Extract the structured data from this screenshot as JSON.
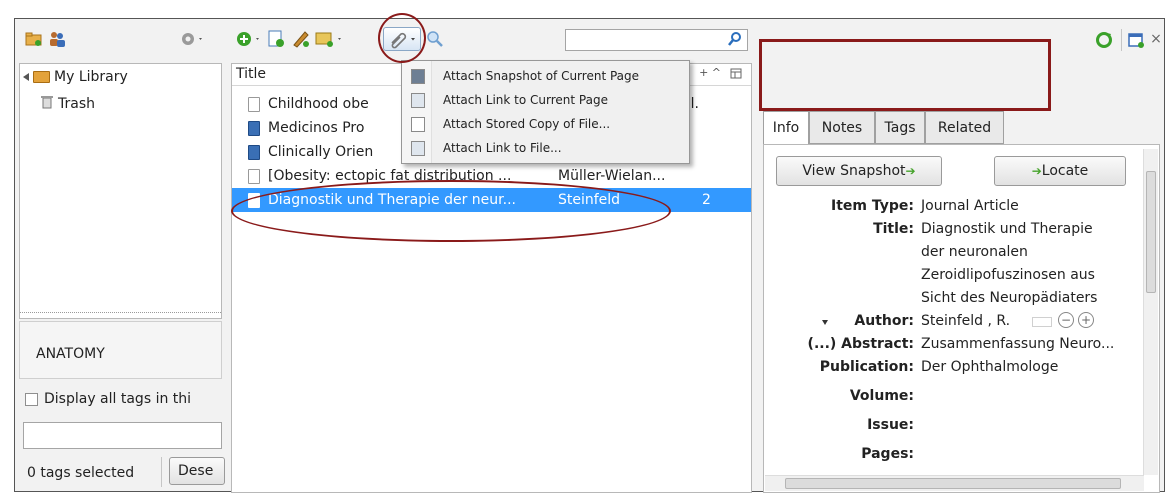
{
  "toolbar": {
    "search_value": "",
    "icons": [
      "new-collection-icon",
      "new-group-icon",
      "actions-gear-icon",
      "new-item-icon",
      "new-note-icon",
      "add-by-identifier-icon",
      "new-note-dropdown-icon",
      "attach-icon",
      "advanced-search-icon",
      "search-icon",
      "sync-icon",
      "fullscreen-icon",
      "close-icon"
    ]
  },
  "library": {
    "items": [
      {
        "label": "My Library"
      },
      {
        "label": "Trash"
      }
    ]
  },
  "tag_selector": {
    "tag": "ANATOMY",
    "display_all_label": "Display all tags in thi",
    "filter_value": "",
    "selected_count": "0 tags selected",
    "deselect_label": "Dese"
  },
  "items": {
    "column_title": "Title",
    "rows": [
      {
        "title": "Childhood obe",
        "extra": "al.",
        "type": "doc"
      },
      {
        "title": "Medicinos Pro",
        "extra": "",
        "type": "book"
      },
      {
        "title": "Clinically Orien",
        "extra": "",
        "type": "book"
      },
      {
        "title": "[Obesity: ectopic fat distribution ...",
        "extra": "Müller-Wielan...",
        "type": "doc"
      },
      {
        "title": "Diagnostik und Therapie der neur...",
        "extra": "Steinfeld",
        "count": "2",
        "type": "doc",
        "selected": true
      }
    ]
  },
  "attach_menu": {
    "items": [
      {
        "label": "Attach Snapshot of Current Page"
      },
      {
        "label": "Attach Link to Current Page"
      },
      {
        "label": "Attach Stored Copy of File..."
      },
      {
        "label": "Attach Link to File..."
      }
    ]
  },
  "item_pane": {
    "tabs": [
      {
        "label": "Info"
      },
      {
        "label": "Notes"
      },
      {
        "label": "Tags"
      },
      {
        "label": "Related"
      }
    ],
    "view_snapshot": "View Snapshot",
    "locate": "Locate",
    "fields": [
      {
        "label": "Item Type:",
        "value": [
          "Journal Article"
        ]
      },
      {
        "label": "Title:",
        "value": [
          "Diagnostik und Therapie",
          "der neuronalen",
          "Zeroidlipofuszinosen aus",
          "Sicht des Neuropädiaters"
        ]
      },
      {
        "label": "Author:",
        "value": [
          "Steinfeld  ,  R."
        ]
      },
      {
        "label": "(...) Abstract:",
        "value": [
          "Zusammenfassung  Neuro..."
        ]
      },
      {
        "label": "Publication:",
        "value": [
          "Der Ophthalmologe"
        ]
      },
      {
        "label": "Volume:",
        "value": [
          ""
        ]
      },
      {
        "label": "Issue:",
        "value": [
          ""
        ]
      },
      {
        "label": "Pages:",
        "value": [
          ""
        ]
      }
    ]
  },
  "colors": {
    "selection": "#3399ff",
    "annotation": "#8a1a1a",
    "accent_green": "#46a32b"
  }
}
